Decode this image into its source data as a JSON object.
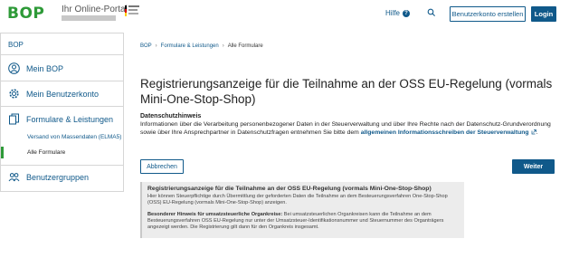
{
  "header": {
    "logo": "BOP",
    "logo_subtitle": "Ihr Online-Portal",
    "help_label": "Hilfe",
    "register_button": "Benutzerkonto erstellen",
    "login_button": "Login"
  },
  "sidebar": {
    "title": "BOP",
    "items": [
      {
        "label": "Mein BOP",
        "icon": "user-circle-icon"
      },
      {
        "label": "Mein Benutzerkonto",
        "icon": "gear-icon"
      },
      {
        "label": "Formulare & Leistungen",
        "icon": "documents-icon"
      },
      {
        "label": "Benutzergruppen",
        "icon": "group-icon"
      }
    ],
    "subitems": [
      {
        "label": "Versand von Massendaten (ELMA5)",
        "active": false
      },
      {
        "label": "Alle Formulare",
        "active": true
      }
    ]
  },
  "breadcrumb": [
    "BOP",
    "Formulare & Leistungen",
    "Alle Formulare"
  ],
  "main": {
    "title": "Registrierungsanzeige für die Teilnahme an der OSS EU-Regelung (vormals Mini-One-Stop-Shop)",
    "privacy_heading": "Datenschutzhinweis",
    "privacy_text": "Informationen über die Verarbeitung personenbezogener Daten in der Steuerverwaltung und über Ihre Rechte nach der Datenschutz-Grundverordnung sowie über Ihre Ansprechpartner in Datenschutzfragen entnehmen Sie bitte dem ",
    "privacy_link": "allgemeinen Informationsschreiben der Steuerverwaltung",
    "privacy_end": ".",
    "cancel_button": "Abbrechen",
    "next_button": "Weiter"
  },
  "infobox": {
    "title": "Registrierungsanzeige für die Teilnahme an der OSS EU-Regelung (vormals Mini-One-Stop-Shop)",
    "text": "Hier können Steuerpflichtige durch Übermittlung der geforderten Daten die Teilnahme an dem Besteuerungsverfahren One-Stop-Shop (OSS) EU-Regelung (vormals Mini-One-Stop-Shop) anzeigen.",
    "note_label": "Besonderer Hinweis für umsatzsteuerliche Organkreise:",
    "note_text": " Bei umsatzsteuerlichen Organkreisen kann die Teilnahme an dem Besteuerungsverfahren OSS EU-Regelung nur unter der Umsatzsteuer-Identifikationsnummer und Steuernummer des Organträgers angezeigt werden. Die Registrierung gilt dann für den Organkreis insgesamt."
  },
  "colors": {
    "brand_green": "#2e9a38",
    "primary_blue": "#10598a"
  }
}
